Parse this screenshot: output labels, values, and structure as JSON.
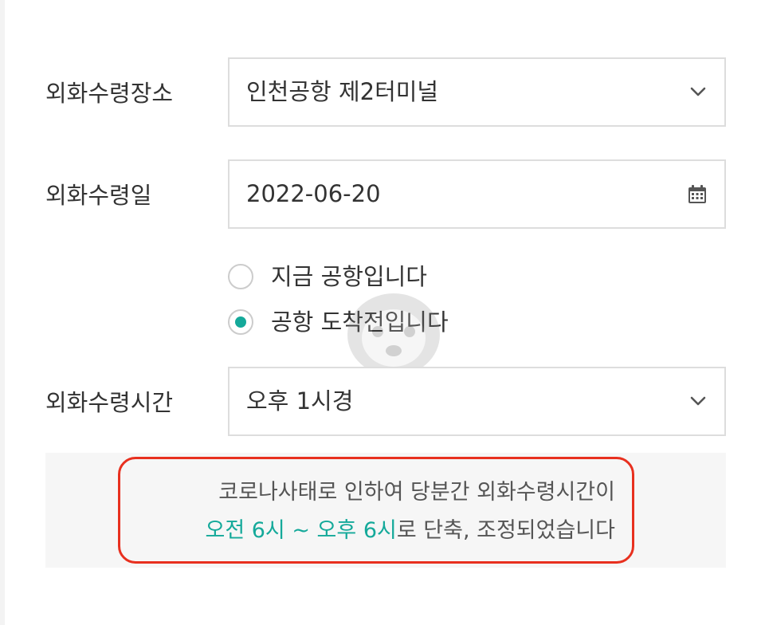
{
  "form": {
    "location": {
      "label": "외화수령장소",
      "value": "인천공항 제2터미널",
      "icon": "chevron-down-icon"
    },
    "date": {
      "label": "외화수령일",
      "value": "2022-06-20",
      "icon": "calendar-icon"
    },
    "airport_status": {
      "options": [
        {
          "label": "지금 공항입니다",
          "checked": false
        },
        {
          "label": "공항 도착전입니다",
          "checked": true
        }
      ]
    },
    "time": {
      "label": "외화수령시간",
      "value": "오후 1시경",
      "icon": "chevron-down-icon"
    }
  },
  "notice": {
    "line1": "코로나사태로 인하여 당분간 외화수령시간이",
    "highlight": "오전 6시 ~ 오후 6시",
    "line2_rest": "로 단축, 조정되었습니다"
  },
  "colors": {
    "accent": "#14a99a",
    "outline": "#e8301f",
    "border": "#dddddd",
    "notice_bg": "#f6f6f6"
  }
}
